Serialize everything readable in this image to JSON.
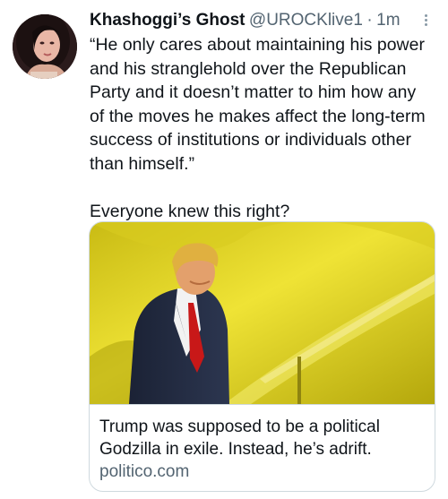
{
  "tweet": {
    "display_name": "Khashoggi’s Ghost",
    "handle": "@UROCKlive1",
    "separator": "·",
    "time": "1m",
    "text": "“He only cares about maintaining his power and his stranglehold over the Republican Party and it doesn’t matter to him how any of the moves he makes affect the long-term success of institutions or individuals other than himself.”\n\nEveryone knew this right?"
  },
  "link_card": {
    "title": "Trump was supposed to be a political Godzilla in exile. Instead, he’s adrift.",
    "domain": "politico.com"
  },
  "colors": {
    "text": "#0f1419",
    "secondary": "#536471",
    "border": "#cfd9de",
    "image_bg": "#e3d51d"
  },
  "icons": {
    "more": "more-vertical-icon"
  }
}
